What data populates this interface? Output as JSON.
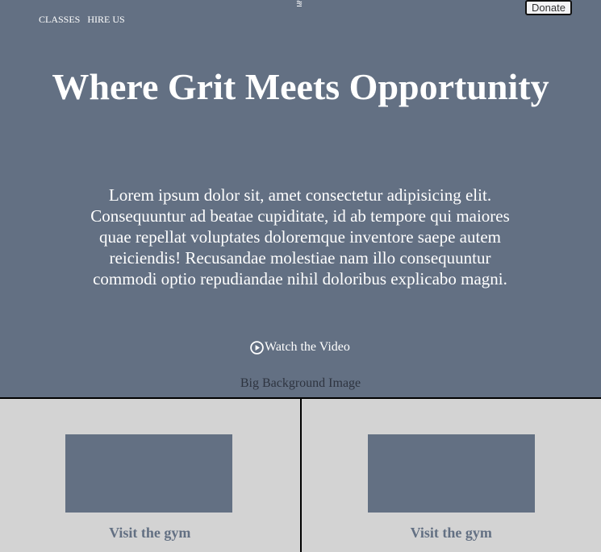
{
  "nav": {
    "items": [
      {
        "label": "CLASSES"
      },
      {
        "label": "HIRE US"
      }
    ]
  },
  "header": {
    "logo_icon": "wavy-logo-icon",
    "donate_label": "Donate"
  },
  "hero": {
    "title": "Where Grit Meets Opportunity",
    "body": "Lorem ipsum dolor sit, amet consectetur adipisicing elit. Consequuntur ad beatae cupiditate, id ab tempore qui maiores quae repellat voluptates doloremque inventore saepe autem reiciendis! Recusandae molestiae nam illo consequuntur commodi optio repudiandae nihil doloribus explicabo magni.",
    "video_icon": "play-circle-icon",
    "video_label": "Watch the Video",
    "background_caption": "Big Background Image"
  },
  "cards": [
    {
      "title": "Visit the gym"
    },
    {
      "title": "Visit the gym"
    }
  ],
  "colors": {
    "hero_background": "#637083",
    "section_background": "#d3d3d3",
    "text_light": "#ffffff",
    "card_title": "#637083"
  }
}
